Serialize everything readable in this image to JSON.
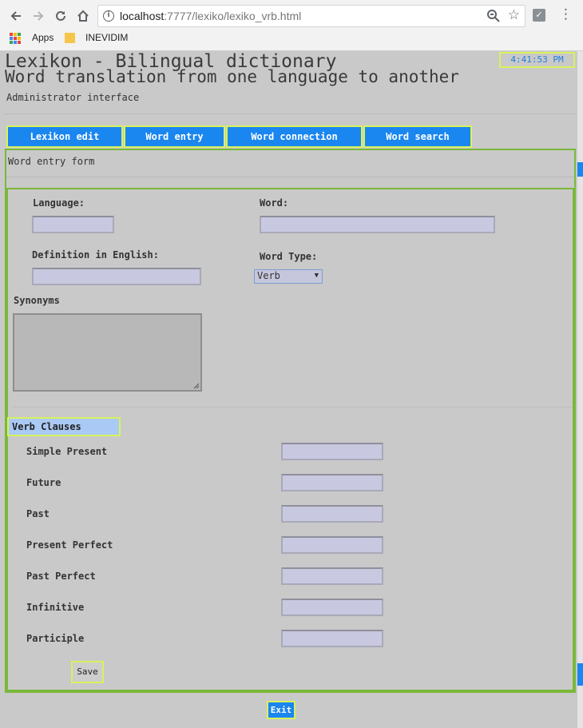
{
  "browser": {
    "url_host": "localhost",
    "url_path": ":7777/lexiko/lexiko_vrb.html",
    "bookmarks": [
      {
        "label": "Apps"
      },
      {
        "label": "INEVIDIM"
      }
    ],
    "apps_colors": [
      "#ea4335",
      "#fbbc05",
      "#34a853",
      "#4285f4",
      "#ea4335",
      "#fbbc05",
      "#34a853",
      "#4285f4",
      "#ea4335"
    ]
  },
  "header": {
    "time": "4:41:53 PM",
    "title": "Lexikon - Bilingual dictionary",
    "subtitle": "Word translation from one language to another",
    "admin": "Administrator interface"
  },
  "tabs": [
    {
      "label": "Lexikon edit"
    },
    {
      "label": "Word entry"
    },
    {
      "label": "Word connection"
    },
    {
      "label": "Word search"
    }
  ],
  "form": {
    "caption": "Word entry form",
    "language_label": "Language:",
    "language_value": "",
    "word_label": "Word:",
    "word_value": "",
    "definition_label": "Definition in English:",
    "definition_value": "",
    "word_type_label": "Word Type:",
    "word_type_value": "Verb",
    "synonyms_label": "Synonyms",
    "verb_section": "Verb Clauses",
    "clauses": [
      {
        "label": "Simple Present",
        "value": ""
      },
      {
        "label": "Future",
        "value": ""
      },
      {
        "label": "Past",
        "value": ""
      },
      {
        "label": "Present Perfect",
        "value": ""
      },
      {
        "label": "Past Perfect",
        "value": ""
      },
      {
        "label": "Infinitive",
        "value": ""
      },
      {
        "label": "Participle",
        "value": ""
      }
    ],
    "save_label": "Save",
    "exit_label": "Exit"
  },
  "colors": {
    "accent_blue": "#1a86f0",
    "highlight_yellow": "#d8f25c",
    "panel_green": "#7ab83a",
    "input_fill": "#c8c8e0",
    "section_fill": "#aac9f4"
  }
}
